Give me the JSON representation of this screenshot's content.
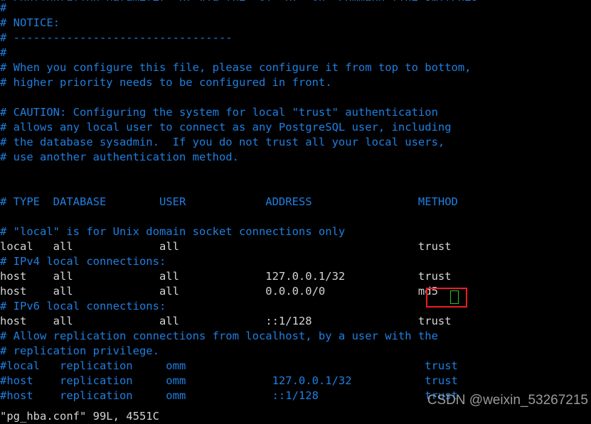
{
  "terminal": {
    "app": "vi",
    "background_color": "#000000",
    "comment_color": "#1f7fe0",
    "active_color": "#d4d4d4",
    "filename": "pg_hba.conf",
    "lines": [
      {
        "text": "# configuration parameter, or via the \"-i\" or \"-h\" command line switches.",
        "kind": "comment",
        "clipped": true
      },
      {
        "text": "#",
        "kind": "comment"
      },
      {
        "text": "# NOTICE:",
        "kind": "comment"
      },
      {
        "text": "# ---------------------------------",
        "kind": "comment"
      },
      {
        "text": "#",
        "kind": "comment"
      },
      {
        "text": "# When you configure this file, please configure it from top to bottom,",
        "kind": "comment"
      },
      {
        "text": "# higher priority needs to be configured in front.",
        "kind": "comment"
      },
      {
        "text": "",
        "kind": "blank"
      },
      {
        "text": "# CAUTION: Configuring the system for local \"trust\" authentication",
        "kind": "comment"
      },
      {
        "text": "# allows any local user to connect as any PostgreSQL user, including",
        "kind": "comment"
      },
      {
        "text": "# the database sysadmin.  If you do not trust all your local users,",
        "kind": "comment"
      },
      {
        "text": "# use another authentication method.",
        "kind": "comment"
      },
      {
        "text": "",
        "kind": "blank"
      },
      {
        "text": "",
        "kind": "blank"
      },
      {
        "text": "# TYPE  DATABASE        USER            ADDRESS                METHOD",
        "kind": "comment"
      },
      {
        "text": "",
        "kind": "blank"
      },
      {
        "text": "# \"local\" is for Unix domain socket connections only",
        "kind": "comment"
      },
      {
        "text": "local   all             all                                    trust",
        "kind": "active"
      },
      {
        "text": "# IPv4 local connections:",
        "kind": "comment"
      },
      {
        "text": "host    all             all             127.0.0.1/32           trust",
        "kind": "active"
      },
      {
        "text": "host    all             all             0.0.0.0/0              md5",
        "kind": "active"
      },
      {
        "text": "# IPv6 local connections:",
        "kind": "comment"
      },
      {
        "text": "host    all             all             ::1/128                trust",
        "kind": "active"
      },
      {
        "text": "# Allow replication connections from localhost, by a user with the",
        "kind": "comment"
      },
      {
        "text": "# replication privilege.",
        "kind": "comment"
      },
      {
        "text": "#local   replication     omm                                    trust",
        "kind": "comment"
      },
      {
        "text": "#host    replication     omm             127.0.0.1/32           trust",
        "kind": "comment"
      },
      {
        "text": "#host    replication     omm             ::1/128                trust",
        "kind": "comment"
      }
    ],
    "status_line": "\"pg_hba.conf\" 99L, 4551C",
    "cursor": {
      "character": "5",
      "outline_color": "#21c521"
    }
  },
  "annotation": {
    "highlight_box": {
      "target_text": "md5",
      "color": "#ee1b24"
    }
  },
  "watermark": {
    "text": "CSDN @weixin_53267215",
    "color": "#a8a8a8"
  }
}
